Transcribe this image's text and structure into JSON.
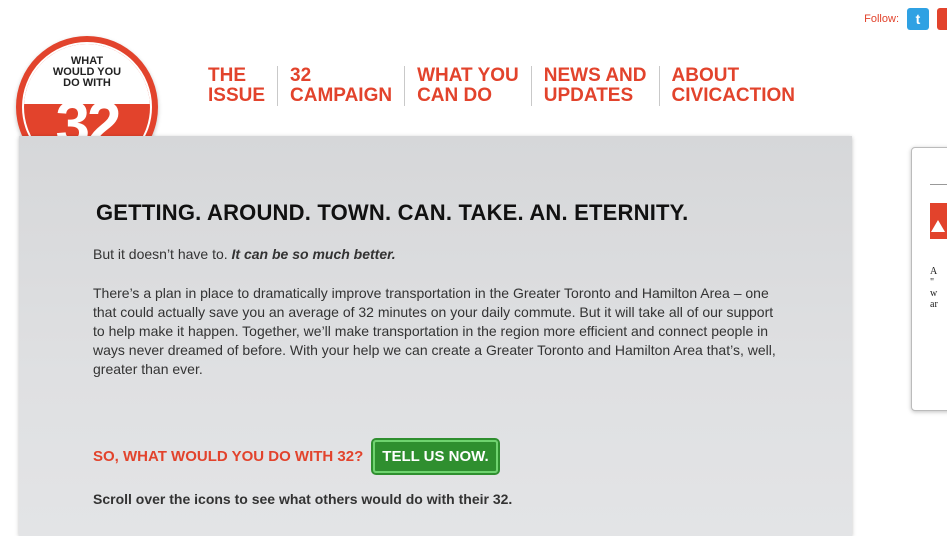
{
  "follow": {
    "label": "Follow:",
    "twitter_icon": "twitter-icon",
    "twitter_glyph": "t"
  },
  "logo": {
    "line1": "WHAT",
    "line2": "WOULD YOU",
    "line3": "DO WITH",
    "number": "32"
  },
  "nav": [
    {
      "label": "THE\nISSUE"
    },
    {
      "label": "32\nCAMPAIGN"
    },
    {
      "label": "WHAT YOU\nCAN DO"
    },
    {
      "label": "NEWS AND\nUPDATES"
    },
    {
      "label": "ABOUT\nCIVICACTION"
    }
  ],
  "main": {
    "headline": "GETTING. AROUND. TOWN. CAN. TAKE. AN. ETERNITY.",
    "lead_plain": "But it doesn’t have to. ",
    "lead_emph": "It can be so much better.",
    "paragraph": "There’s a plan in place to dramatically improve transportation in the Greater Toronto and Hamilton Area – one that could actually save you an average of 32 minutes on your daily commute. But it will take all of our support to help make it happen. Together, we’ll make transportation in the region more efficient and connect people in ways never dreamed of before. With your help we can create a Greater Toronto and Hamilton Area that’s, well, greater than ever.",
    "cta_question": "SO, WHAT WOULD YOU DO WITH 32?",
    "cta_button": "TELL US NOW.",
    "scroll_hint": "Scroll over the icons to see what others would do with their 32."
  },
  "side_card": {
    "text": "A\n\"\nw\nar"
  },
  "colors": {
    "accent": "#e2432c",
    "button": "#2f8f2f",
    "twitter": "#2fa1e3"
  }
}
